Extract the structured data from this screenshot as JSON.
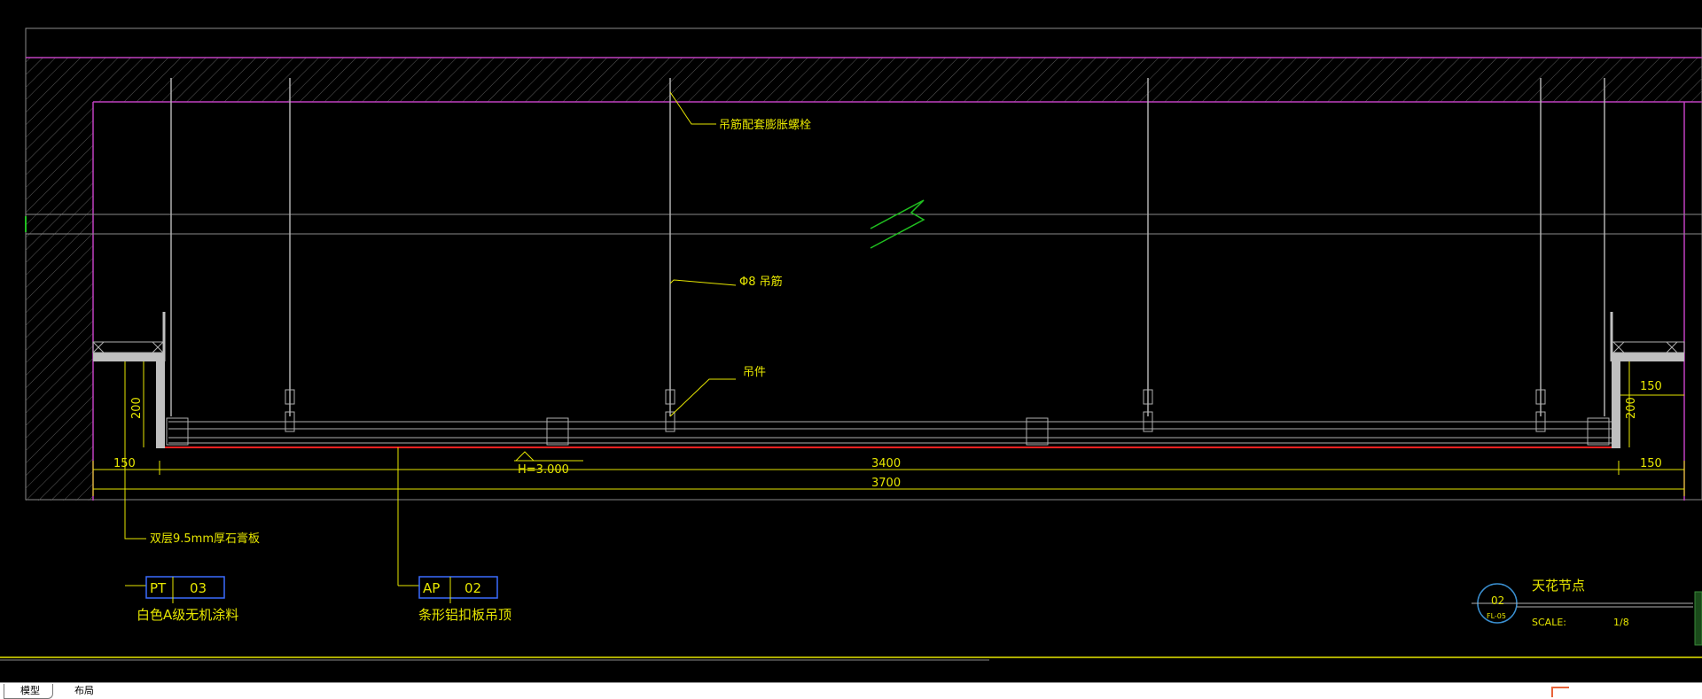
{
  "annotations": {
    "bolt": "吊筋配套膨胀螺栓",
    "rod": "Φ8 吊筋",
    "hanger": "吊件",
    "gypsum": "双层9.5mm厚石膏板"
  },
  "dimensions": {
    "left_offset": "150",
    "right_offset": "150",
    "right_top": "150",
    "left_height": "200",
    "right_height": "200",
    "inner_span": "3400",
    "total_span": "3700",
    "elevation": "H=3.000"
  },
  "tags": [
    {
      "code": "PT",
      "num": "03",
      "desc": "白色A级无机涂料"
    },
    {
      "code": "AP",
      "num": "02",
      "desc": "条形铝扣板吊顶"
    }
  ],
  "title_block": {
    "detail_no": "02",
    "sheet_ref": "FL-05",
    "title": "天花节点",
    "scale_label": "SCALE:",
    "scale_value": "1/8"
  },
  "tabs": {
    "model": "模型",
    "layout": "布局"
  },
  "colors": {
    "background": "#000000",
    "slab_line": "#c040c0",
    "annotation": "#e6e600",
    "tag_box": "#3a6cff",
    "ceiling_line": "#ff2020",
    "break_mark": "#20c020",
    "structure": "#a0a0a0"
  }
}
